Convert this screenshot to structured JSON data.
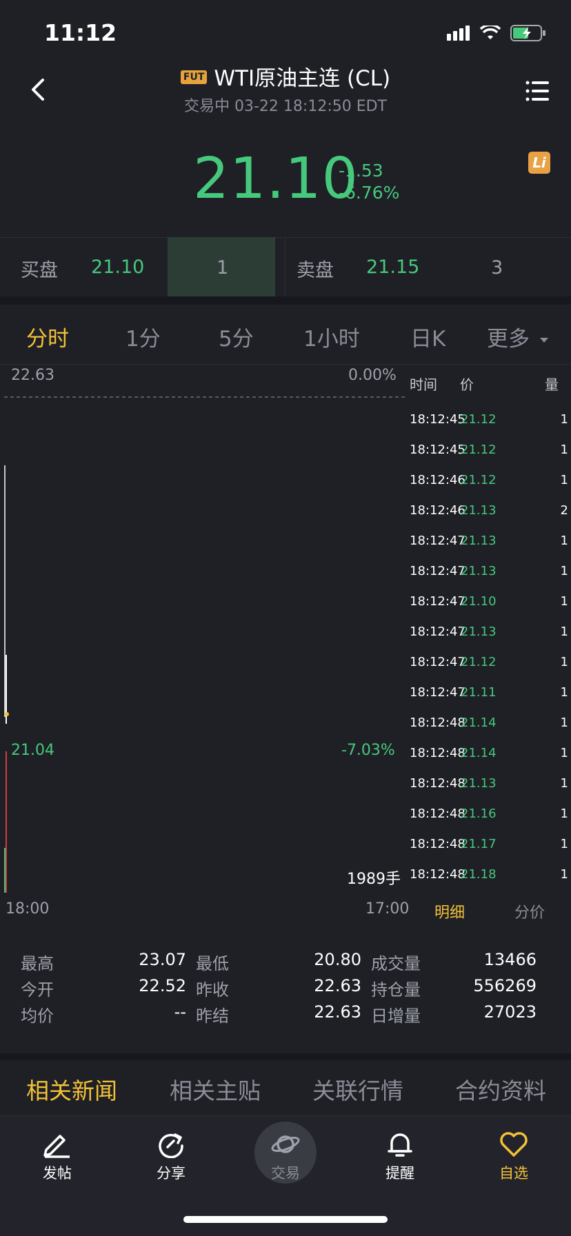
{
  "status": {
    "time": "11:12"
  },
  "header": {
    "badge": "FUT",
    "title": "WTI原油主连 (CL)",
    "subtitle": "交易中 03-22 18:12:50 EDT"
  },
  "quote": {
    "price": "21.10",
    "change": "-1.53",
    "change_pct": "-6.76%",
    "li_icon": "Li"
  },
  "orderbook": {
    "bid_label": "买盘",
    "bid_price": "21.10",
    "bid_qty": "1",
    "ask_label": "卖盘",
    "ask_price": "21.15",
    "ask_qty": "3"
  },
  "period_tabs": [
    "分时",
    "1分",
    "5分",
    "1小时",
    "日K",
    "更多"
  ],
  "chart": {
    "top_price": "22.63",
    "top_pct": "0.00%",
    "low_price": "21.04",
    "low_pct": "-7.03%",
    "volume": "1989手",
    "x_start": "18:00",
    "x_end": "17:00"
  },
  "ticks": {
    "headers": [
      "时间",
      "价",
      "量"
    ],
    "rows": [
      {
        "t": "18:12:45",
        "p": "21.12",
        "v": "1"
      },
      {
        "t": "18:12:45",
        "p": "21.12",
        "v": "1"
      },
      {
        "t": "18:12:46",
        "p": "21.12",
        "v": "1"
      },
      {
        "t": "18:12:46",
        "p": "21.13",
        "v": "2"
      },
      {
        "t": "18:12:47",
        "p": "21.13",
        "v": "1"
      },
      {
        "t": "18:12:47",
        "p": "21.13",
        "v": "1"
      },
      {
        "t": "18:12:47",
        "p": "21.10",
        "v": "1"
      },
      {
        "t": "18:12:47",
        "p": "21.13",
        "v": "1"
      },
      {
        "t": "18:12:47",
        "p": "21.12",
        "v": "1"
      },
      {
        "t": "18:12:47",
        "p": "21.11",
        "v": "1"
      },
      {
        "t": "18:12:48",
        "p": "21.14",
        "v": "1"
      },
      {
        "t": "18:12:48",
        "p": "21.14",
        "v": "1"
      },
      {
        "t": "18:12:48",
        "p": "21.13",
        "v": "1"
      },
      {
        "t": "18:12:48",
        "p": "21.16",
        "v": "1"
      },
      {
        "t": "18:12:48",
        "p": "21.17",
        "v": "1"
      },
      {
        "t": "18:12:48",
        "p": "21.18",
        "v": "1"
      }
    ],
    "tab_detail": "明细",
    "tab_price": "分价"
  },
  "stats": {
    "high_label": "最高",
    "high": "23.07",
    "low_label": "最低",
    "low": "20.80",
    "vol_label": "成交量",
    "vol": "13466",
    "open_label": "今开",
    "open": "22.52",
    "prevclose_label": "昨收",
    "prevclose": "22.63",
    "oi_label": "持仓量",
    "oi": "556269",
    "avg_label": "均价",
    "avg": "--",
    "prevsettle_label": "昨结",
    "prevsettle": "22.63",
    "daily_inc_label": "日增量",
    "daily_inc": "27023"
  },
  "news_tabs": [
    "相关新闻",
    "相关主贴",
    "关联行情",
    "合约资料"
  ],
  "bottom_nav": [
    "发帖",
    "分享",
    "交易",
    "提醒",
    "自选"
  ],
  "colors": {
    "up_green": "#46c97c",
    "accent_yellow": "#f4c236",
    "background": "#1f2026"
  }
}
